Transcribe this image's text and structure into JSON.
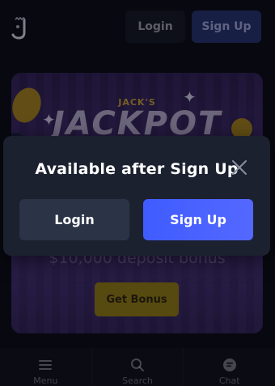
{
  "header": {
    "logo_icon": "j-logo-icon",
    "login_label": "Login",
    "signup_label": "Sign Up"
  },
  "banner": {
    "subtitle": "JACK'S",
    "title": "JACKPOT",
    "bonus_text": "$10,000 deposit bonus",
    "cta_label": "Get Bonus"
  },
  "modal": {
    "title": "Available after Sign Up",
    "close_icon": "close-icon",
    "login_label": "Login",
    "signup_label": "Sign Up"
  },
  "bottom_nav": {
    "items": [
      {
        "label": "Menu",
        "icon": "hamburger-icon"
      },
      {
        "label": "Search",
        "icon": "search-icon"
      },
      {
        "label": "Chat",
        "icon": "chat-icon"
      }
    ]
  },
  "colors": {
    "background": "#0b0c12",
    "modal": "#1c2130",
    "login_button": "#2b3347",
    "signup_button": "#4a62ff"
  }
}
